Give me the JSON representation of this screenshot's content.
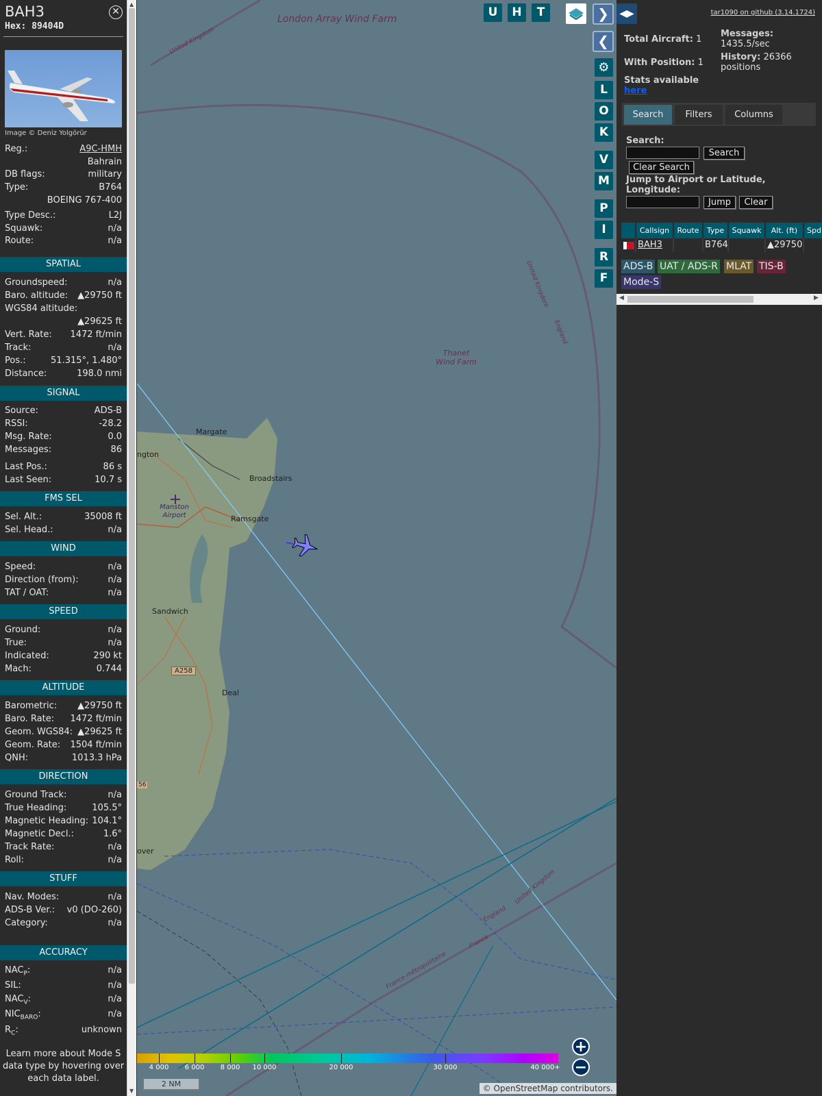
{
  "aircraft": {
    "callsign": "BAH3",
    "hex": "Hex: 89404D",
    "photo_credit": "Image © Deniz Yolgörür",
    "close_icon": "close-icon"
  },
  "details": {
    "reg_label": "Reg.:",
    "reg_value": "A9C-HMH",
    "country": "Bahrain",
    "dbflags_label": "DB flags:",
    "dbflags_value": "military",
    "type_label": "Type:",
    "type_value": "B764",
    "type_name": "BOEING 767-400",
    "typedesc_label": "Type Desc.:",
    "typedesc_value": "L2J",
    "squawk_label": "Squawk:",
    "squawk_value": "n/a",
    "route_label": "Route:",
    "route_value": "n/a"
  },
  "sections": {
    "spatial": "SPATIAL",
    "signal": "SIGNAL",
    "fms": "FMS SEL",
    "wind": "WIND",
    "speed": "SPEED",
    "altitude": "ALTITUDE",
    "direction": "DIRECTION",
    "stuff": "STUFF",
    "accuracy": "ACCURACY"
  },
  "spatial": {
    "gs_label": "Groundspeed:",
    "gs_value": "n/a",
    "baro_label": "Baro. altitude:",
    "baro_value": "▲29750 ft",
    "wgs_label": "WGS84 altitude:",
    "wgs_value": "▲29625 ft",
    "vr_label": "Vert. Rate:",
    "vr_value": "1472 ft/min",
    "track_label": "Track:",
    "track_value": "n/a",
    "pos_label": "Pos.:",
    "pos_value": "51.315°, 1.480°",
    "dist_label": "Distance:",
    "dist_value": "198.0 nmi"
  },
  "signal": {
    "source_label": "Source:",
    "source_value": "ADS-B",
    "rssi_label": "RSSI:",
    "rssi_value": "-28.2",
    "msgrate_label": "Msg. Rate:",
    "msgrate_value": "0.0",
    "messages_label": "Messages:",
    "messages_value": "86",
    "lastpos_label": "Last Pos.:",
    "lastpos_value": "86 s",
    "lastseen_label": "Last Seen:",
    "lastseen_value": "10.7 s"
  },
  "fms": {
    "selalt_label": "Sel. Alt.:",
    "selalt_value": "35008 ft",
    "selhead_label": "Sel. Head.:",
    "selhead_value": "n/a"
  },
  "wind": {
    "speed_label": "Speed:",
    "speed_value": "n/a",
    "dir_label": "Direction (from):",
    "dir_value": "n/a",
    "tat_label": "TAT / OAT:",
    "tat_value": "n/a"
  },
  "speed": {
    "ground_label": "Ground:",
    "ground_value": "n/a",
    "true_label": "True:",
    "true_value": "n/a",
    "ias_label": "Indicated:",
    "ias_value": "290 kt",
    "mach_label": "Mach:",
    "mach_value": "0.744"
  },
  "altitude": {
    "baro_label": "Barometric:",
    "baro_value": "▲29750 ft",
    "barorate_label": "Baro. Rate:",
    "barorate_value": "1472 ft/min",
    "geom_label": "Geom. WGS84:",
    "geom_value": "▲29625 ft",
    "geomrate_label": "Geom. Rate:",
    "geomrate_value": "1504 ft/min",
    "qnh_label": "QNH:",
    "qnh_value": "1013.3 hPa"
  },
  "direction": {
    "gtrack_label": "Ground Track:",
    "gtrack_value": "n/a",
    "thead_label": "True Heading:",
    "thead_value": "105.5°",
    "mhead_label": "Magnetic Heading:",
    "mhead_value": "104.1°",
    "mdecl_label": "Magnetic Decl.:",
    "mdecl_value": "1.6°",
    "trate_label": "Track Rate:",
    "trate_value": "n/a",
    "roll_label": "Roll:",
    "roll_value": "n/a"
  },
  "stuff": {
    "nav_label": "Nav. Modes:",
    "nav_value": "n/a",
    "adsb_label": "ADS-B Ver.:",
    "adsb_value": "v0 (DO-260)",
    "cat_label": "Category:",
    "cat_value": "n/a"
  },
  "accuracy": {
    "nacp_label": "NAC",
    "nacp_sub": "P",
    "nacp_suffix": ":",
    "nacp_value": "n/a",
    "sil_label": "SIL:",
    "sil_value": "n/a",
    "nacv_label": "NAC",
    "nacv_sub": "V",
    "nacv_suffix": ":",
    "nacv_value": "n/a",
    "nicbaro_label": "NIC",
    "nicbaro_sub": "BARO",
    "nicbaro_suffix": ":",
    "nicbaro_value": "n/a",
    "rc_label": "R",
    "rc_sub": "C",
    "rc_suffix": ":",
    "rc_value": "unknown"
  },
  "learn_more": "Learn more about Mode S data type by hovering over each data label.",
  "map": {
    "buttons": [
      "U",
      "H",
      "T"
    ],
    "side_buttons": [
      "L",
      "O",
      "K",
      "V",
      "M",
      "P",
      "I",
      "R",
      "F"
    ],
    "labels": {
      "london_array": "London Array Wind Farm",
      "thanet": "Thanet Wind Farm",
      "margate": "Margate",
      "ngton": "ngton",
      "broadstairs": "Broadstairs",
      "manston": "Manston Airport",
      "ramsgate": "Ramsgate",
      "sandwich": "Sandwich",
      "a258": "A258",
      "deal": "Deal",
      "a56": "56",
      "dover": "over",
      "uk1": "United Kingdom",
      "uk2": "United Kingdom",
      "england1": "England",
      "uk3": "United Kingdom",
      "england2": "England",
      "france": "France",
      "france_metro": "France métropolitaine"
    },
    "legend_ticks": [
      "4 000",
      "6 000",
      "8 000",
      "10 000",
      "20 000",
      "30 000",
      "40 000+"
    ],
    "scale": "2 NM",
    "attribution": "© OpenStreetMap contributors.",
    "zoom_in": "+",
    "zoom_out": "−"
  },
  "side": {
    "github": "tar1090 on github (3.14.1724)",
    "total_label": "Total Aircraft:",
    "total_value": "1",
    "messages_label": "Messages:",
    "messages_value": "1435.5/sec",
    "withpos_label": "With Position:",
    "withpos_value": "1",
    "history_label": "History:",
    "history_value": "26366 positions",
    "stats_label": "Stats available",
    "here": "here",
    "tabs": [
      "Search",
      "Filters",
      "Columns"
    ],
    "search_label": "Search:",
    "search_button": "Search",
    "clear_search": "Clear Search",
    "jump_label": "Jump to Airport or Latitude, Longitude:",
    "jump_button": "Jump",
    "clear_button": "Clear",
    "columns": [
      "Callsign",
      "Route",
      "Type",
      "Squawk",
      "Alt. (ft)",
      "Spd"
    ],
    "row": {
      "callsign": "BAH3",
      "route": "",
      "type": "B764",
      "squawk": "",
      "alt": "▲29750"
    },
    "sources": [
      "ADS-B",
      "UAT / ADS-R",
      "MLAT",
      "TIS-B",
      "Mode-S"
    ]
  },
  "colors": {
    "panel_bg": "#2b2b2b",
    "section_bg": "#00596b",
    "map_sea": "#5f7a86",
    "adsb": "#2a5868",
    "uat": "#2e6a3c",
    "mlat": "#6a5a28",
    "tisb": "#6a2438",
    "modes": "#38366a"
  }
}
